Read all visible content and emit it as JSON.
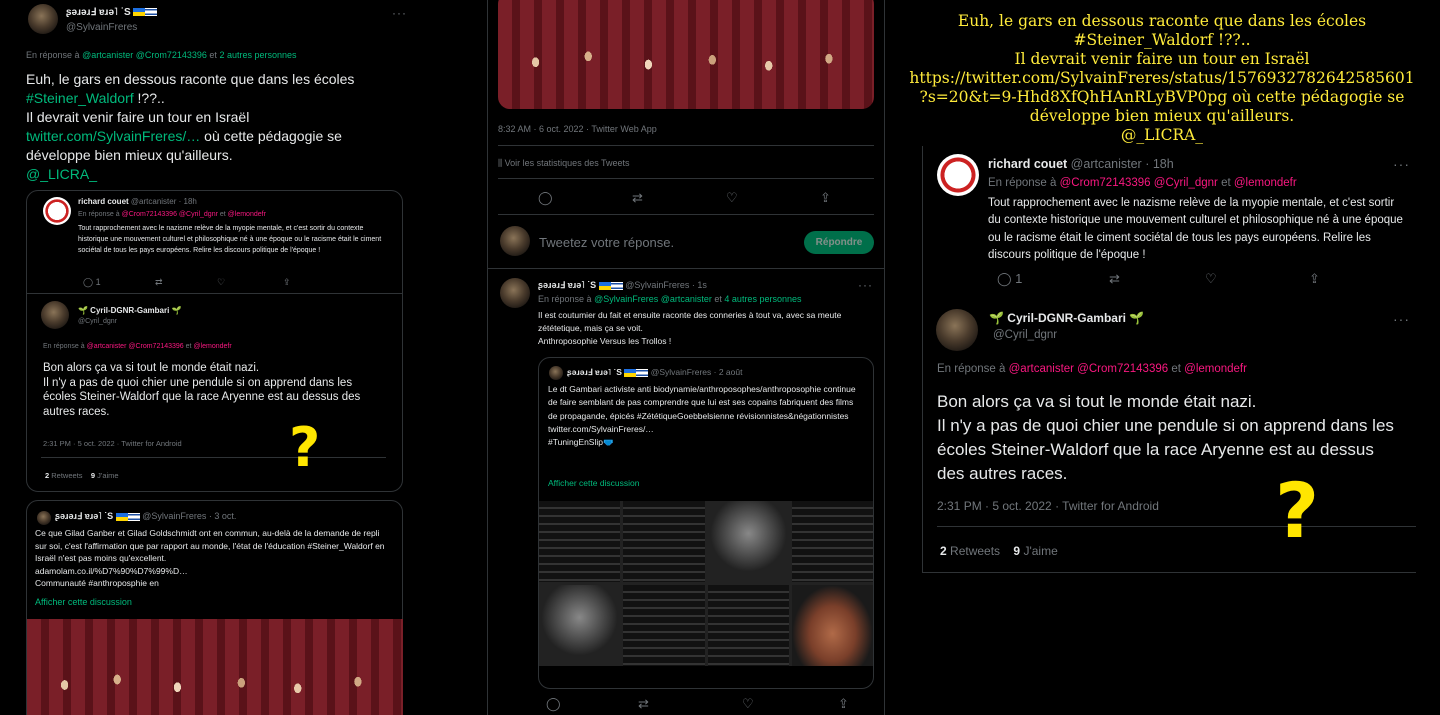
{
  "col1": {
    "header_name": "ʂǝɹǝɹℲ ɐɹǝ˥ ˙S",
    "header_handle": "@SylvainFreres",
    "menu_dots": "···",
    "reply_to_prefix": "En réponse à",
    "reply_to_users": "@artcanister @Crom72143396",
    "reply_to_and": "et",
    "reply_to_others": "2 autres personnes",
    "tweet_line1": "Euh, le gars en dessous raconte que dans les écoles",
    "hashtag": "#Steiner_Waldorf",
    "tweet_after_hashtag": "!??..",
    "tweet_line3": "Il devrait venir faire un tour en Israël",
    "link": "twitter.com/SylvainFreres/…",
    "tweet_after_link": "où cette pédagogie se",
    "tweet_line5": "développe bien mieux qu'ailleurs.",
    "mention": "@_LICRA_",
    "quote": {
      "rc_name": "richard couet",
      "rc_handle_time": "@artcanister · 18h",
      "rc_reply_prefix": "En réponse à",
      "rc_reply_users": "@Crom72143396 @Cyril_dgnr",
      "rc_reply_and": "et",
      "rc_reply_last": "@lemondefr",
      "rc_text": "Tout rapprochement avec le nazisme relève de la myopie  mentale, et c'est sortir du contexte historique une mouvement culturel et philosophique né à une époque ou le racisme était le ciment sociétal de tous les pays européens. Relire les discours politique de l'époque !",
      "rc_reply_count": "1",
      "cy_name": "🌱 Cyril-DGNR-Gambari 🌱",
      "cy_handle": "@Cyril_dgnr",
      "cy_reply_prefix": "En réponse à",
      "cy_reply_users": "@artcanister @Crom72143396",
      "cy_reply_and": "et",
      "cy_reply_last": "@lemondefr",
      "cy_text": "Bon alors ça va si tout le monde était nazi.\nIl n'y a pas de quoi chier une pendule si on apprend dans les écoles Steiner-Waldorf que la race Aryenne est au dessus des autres races.",
      "cy_time": "2:31 PM · 5 oct. 2022 · Twitter for Android",
      "retweets_num": "2",
      "retweets_label": "Retweets",
      "likes_num": "9",
      "likes_label": "J'aime",
      "qmark": "?"
    },
    "quote2": {
      "name": "ʂǝɹǝɹℲ ɐɹǝ˥ ˙S",
      "handle_time": "@SylvainFreres · 3 oct.",
      "text": "Ce que Gilad Ganber et Gilad Goldschmidt ont en commun, au-delà de la demande de repli sur soi, c'est l'affirmation que par rapport au monde, l'état de l'éducation #Steiner_Waldorf en Israël n'est pas moins qu'excellent.\nadamolam.co.il/%D7%90%D7%99%D…\nCommunauté #anthroposphie en",
      "show_thread": "Afficher cette discussion"
    }
  },
  "col2": {
    "top_time": "8:32 AM · 6 oct. 2022 · Twitter Web App",
    "stats": "Voir les statistiques des Tweets",
    "reply_placeholder": "Tweetez votre réponse.",
    "reply_button": "Répondre",
    "tw_name": "ʂǝɹǝɹℲ ɐɹǝ˥ ˙S",
    "tw_handle_time": "@SylvainFreres · 1s",
    "tw_reply_prefix": "En réponse à",
    "tw_reply_users": "@SylvainFreres @artcanister",
    "tw_reply_and": "et",
    "tw_reply_others": "4 autres personnes",
    "tw_text": "Il est coutumier du fait et ensuite raconte des conneries à tout va, avec sa meute zététetique, mais ça se voit.\nAnthroposophie Versus les Trollos !",
    "quote": {
      "name": "ʂǝɹǝɹℲ ɐɹǝ˥ ˙S",
      "handle_time": "@SylvainFreres · 2 août",
      "text": "Le dt Gambari activiste anti biodynamie/anthroposophes/anthroposophie continue de faire semblant de pas comprendre que lui est ses copains fabriquent des films de propagande, épicés #ZététiqueGoebbelsienne révisionnistes&négationnistes\ntwitter.com/SylvainFreres/…\n#TuningEnSlip🩲",
      "show_thread": "Afficher cette discussion"
    }
  },
  "col3": {
    "caption": "Euh, le gars en dessous raconte que dans les écoles #Steiner_Waldorf !??..\nIl devrait venir faire un tour en Israël https://twitter.com/SylvainFreres/status/1576932782642585601?s=20&t=9-Hhd8XfQhHAnRLyBVP0pg où cette pédagogie se développe bien mieux qu'ailleurs.\n@_LICRA_",
    "rc_name": "richard couet",
    "rc_handle_time": "@artcanister · 18h",
    "rc_reply_prefix": "En réponse à",
    "rc_reply_users": "@Crom72143396 @Cyril_dgnr",
    "rc_reply_and": "et",
    "rc_reply_last": "@lemondefr",
    "rc_text": "Tout rapprochement avec le nazisme relève de la myopie  mentale, et c'est sortir du contexte historique une mouvement culturel et philosophique né à une époque ou le racisme était le ciment sociétal de tous les pays européens. Relire les discours politique de l'époque !",
    "rc_reply_count": "1",
    "cy_name": "🌱 Cyril-DGNR-Gambari 🌱",
    "cy_handle": "@Cyril_dgnr",
    "cy_reply_prefix": "En réponse à",
    "cy_reply_users": "@artcanister @Crom72143396",
    "cy_reply_and": "et",
    "cy_reply_last": "@lemondefr",
    "cy_text": "Bon alors ça va si tout le monde était nazi.\nIl n'y a pas de quoi chier une pendule si on apprend dans les écoles Steiner-Waldorf que la race Aryenne est au dessus des autres races.",
    "cy_time": "2:31 PM · 5 oct. 2022 · Twitter for Android",
    "retweets_num": "2",
    "retweets_label": "Retweets",
    "likes_num": "9",
    "likes_label": "J'aime",
    "qmark": "?"
  },
  "colors": {
    "accent": "#1d9bf0",
    "hashtag": "#00ba7c",
    "mention": "#f91880",
    "caption": "#ffeb3b",
    "reply_button": "#00ba7c"
  },
  "icons": [
    "reply-icon",
    "retweet-icon",
    "like-icon",
    "share-icon",
    "stats-icon",
    "more-icon"
  ]
}
